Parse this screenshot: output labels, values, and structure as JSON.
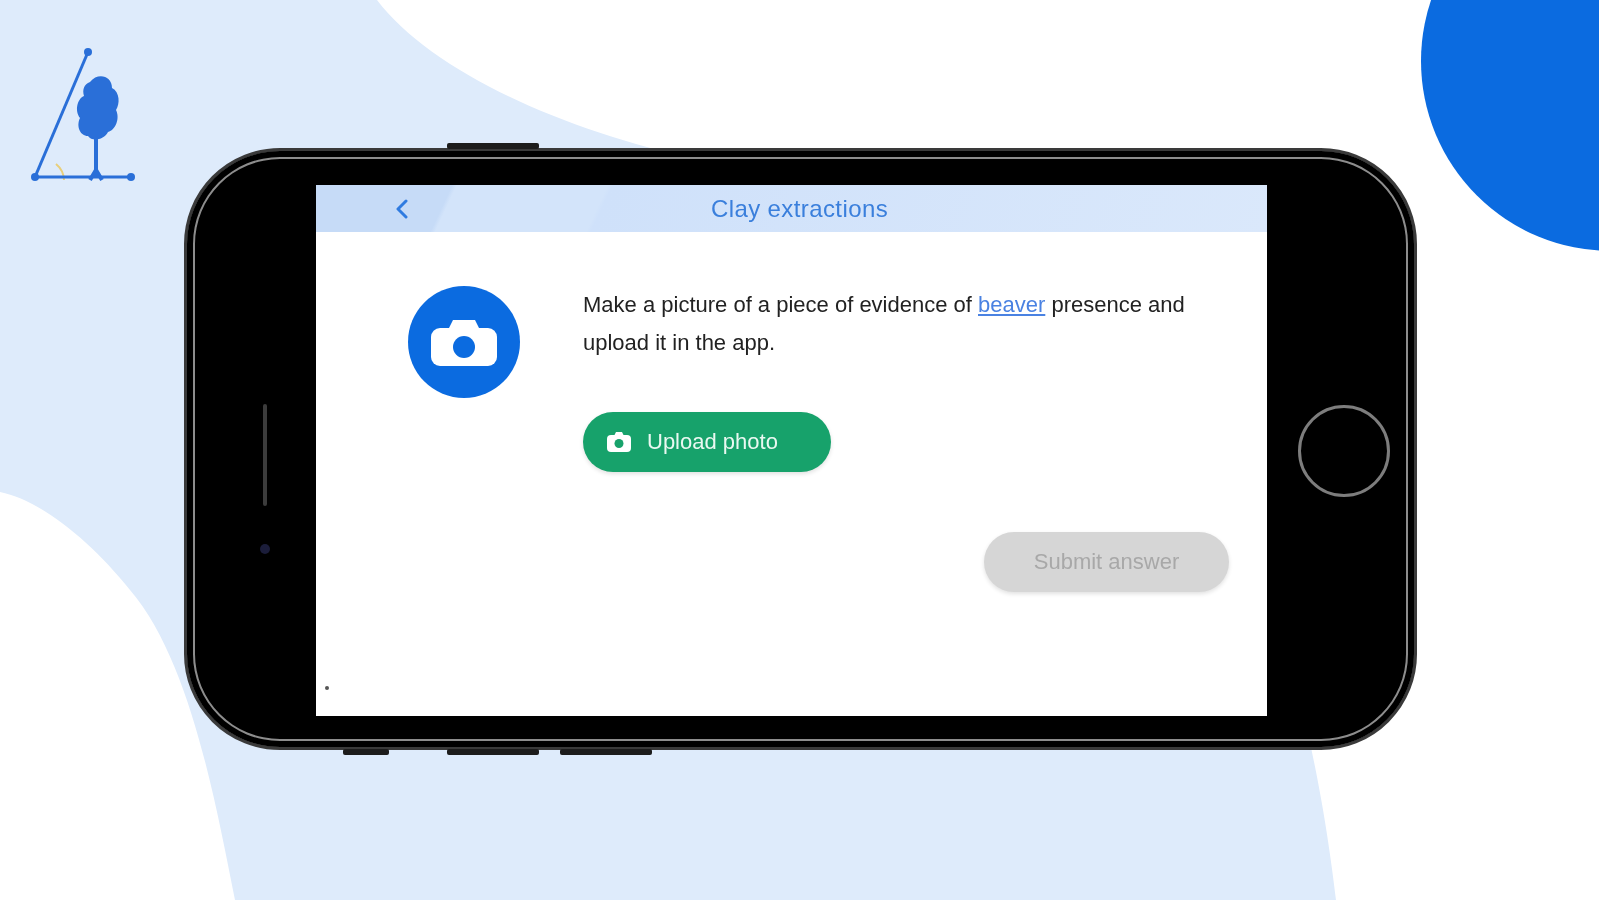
{
  "header": {
    "title": "Clay extractions"
  },
  "task": {
    "text_parts": [
      {
        "kind": "text",
        "text": "Make a picture of a piece of evidence of "
      },
      {
        "kind": "link",
        "text": "beaver"
      },
      {
        "kind": "text",
        "text": " presence and upload it in the app."
      }
    ]
  },
  "buttons": [
    {
      "kind": "upload",
      "label": "Upload photo",
      "disabled": false
    },
    {
      "kind": "submit",
      "label": "Submit answer",
      "disabled": true
    }
  ]
}
